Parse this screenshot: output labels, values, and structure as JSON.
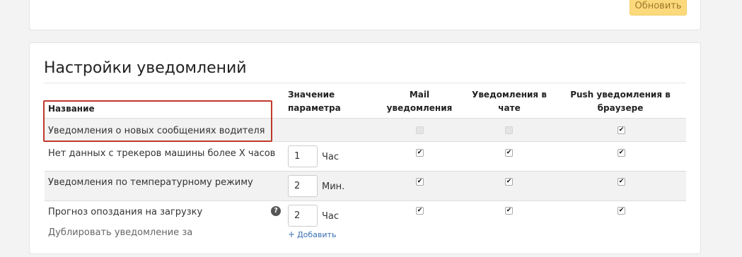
{
  "toolbar": {
    "refresh_label": "Обновить"
  },
  "settings": {
    "title": "Настройки уведомлений",
    "columns": {
      "name": "Название",
      "param_line1": "Значение",
      "param_line2": "параметра",
      "mail_line1": "Mail",
      "mail_line2": "уведомления",
      "chat_line1": "Уведомления в",
      "chat_line2": "чате",
      "push_line1": "Push уведомления в",
      "push_line2": "браузере"
    },
    "rows": [
      {
        "name": "Уведомления о новых сообщениях водителя",
        "mail": false,
        "chat": false,
        "push": true,
        "mail_disabled": true,
        "chat_disabled": true
      },
      {
        "name": "Нет данных с трекеров машины более X часов",
        "value": "1",
        "unit": "Час",
        "mail": true,
        "chat": true,
        "push": true
      },
      {
        "name": "Уведомления по температурному режиму",
        "value": "2",
        "unit": "Мин.",
        "mail": true,
        "chat": true,
        "push": true
      },
      {
        "name": "Прогноз опоздания на загрузку",
        "value": "2",
        "unit": "Час",
        "mail": true,
        "chat": true,
        "push": true,
        "sub_label": "Дублировать уведомление за",
        "add_label": "Добавить"
      }
    ]
  },
  "icons": {
    "check": "✔",
    "help": "?",
    "plus": "+"
  },
  "colors": {
    "accent_button": "#fcd97b",
    "highlight": "#c0392b",
    "link": "#3a6fb0"
  }
}
